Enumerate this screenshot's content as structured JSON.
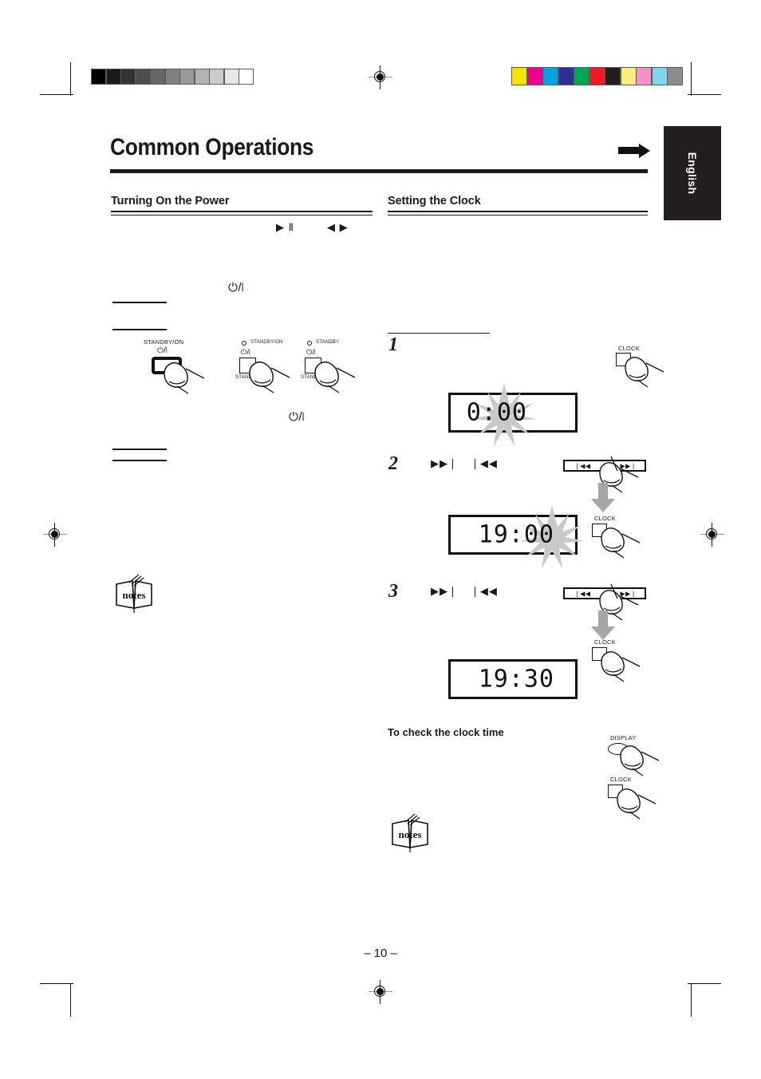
{
  "document": {
    "title": "Common Operations",
    "language_tab": "English",
    "page_number": "– 10 –"
  },
  "print_marks": {
    "gray_scale_swatches": [
      "#000000",
      "#1a1a1a",
      "#333333",
      "#4d4d4d",
      "#666666",
      "#808080",
      "#999999",
      "#b3b3b3",
      "#cccccc",
      "#e6e6e6",
      "#ffffff"
    ],
    "color_swatches": [
      "#f5e400",
      "#ec008c",
      "#00a3e0",
      "#2e3192",
      "#00a651",
      "#ed1c24",
      "#231f20",
      "#faed7f",
      "#f790c4",
      "#7fd4f2",
      "#8c8c8c"
    ],
    "registration_mark": "registration-crosshair"
  },
  "sections": {
    "left": {
      "heading": "Turning On the Power",
      "transport_glyphs": [
        "▶ Ⅱ",
        "◀ ▶"
      ],
      "power_symbol": "⏻/❘",
      "power_symbol_2": "⏻/❘",
      "buttons": [
        {
          "id": "standby-on-main-unit",
          "top_label": "STANDBY/ON",
          "symbol": "⏻/❘",
          "style": "thick-rounded"
        },
        {
          "id": "standby-on-remote-a",
          "led_label": "STANDBY/ON",
          "symbol": "⏻/❘",
          "bottom_label": "STANDBY/ON",
          "style": "square"
        },
        {
          "id": "standby-remote-b",
          "led_label": "STANDBY",
          "symbol": "⏻/❘",
          "bottom_label": "STANDBY/ON",
          "style": "square"
        }
      ],
      "notes_icon_label": "notes"
    },
    "right": {
      "heading": "Setting the Clock",
      "steps": [
        {
          "number": "1",
          "button_label": "CLOCK",
          "display_value": "0:00",
          "display_flashing": true,
          "flash_target": "whole"
        },
        {
          "number": "2",
          "glyphs": [
            "▶▶❘",
            "❘◀◀"
          ],
          "skip_bar": {
            "left_label": "❘◀◀",
            "right_label": "▶▶❘"
          },
          "button_label": "CLOCK",
          "display_value": "19:00",
          "display_flashing": true,
          "flash_target": "minutes"
        },
        {
          "number": "3",
          "glyphs": [
            "▶▶❘",
            "❘◀◀"
          ],
          "skip_bar": {
            "left_label": "❘◀◀",
            "right_label": "▶▶❘"
          },
          "button_label": "CLOCK",
          "display_value": "19:30",
          "display_flashing": false
        }
      ],
      "check_clock": {
        "heading": "To check the clock time",
        "buttons": [
          {
            "id": "display-button",
            "label": "DISPLAY",
            "shape": "oval"
          },
          {
            "id": "clock-button",
            "label": "CLOCK",
            "shape": "square"
          }
        ]
      },
      "notes_icon_label": "notes"
    }
  }
}
